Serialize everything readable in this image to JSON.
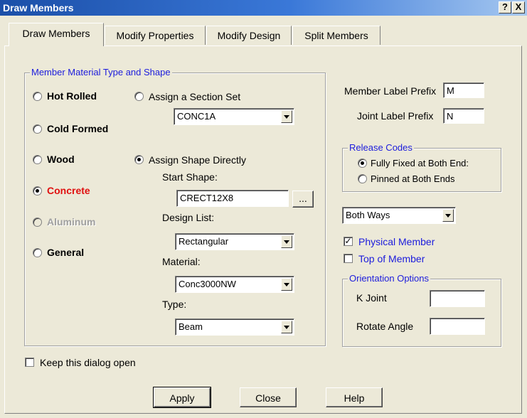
{
  "window": {
    "title": "Draw Members",
    "help_btn": "?",
    "close_btn": "X"
  },
  "tabs": [
    {
      "label": "Draw Members"
    },
    {
      "label": "Modify Properties"
    },
    {
      "label": "Modify Design"
    },
    {
      "label": "Split Members"
    }
  ],
  "material_group": {
    "legend": "Member Material Type and Shape",
    "types": [
      {
        "label": "Hot Rolled",
        "checked": false,
        "disabled": false
      },
      {
        "label": "Cold Formed",
        "checked": false,
        "disabled": false
      },
      {
        "label": "Wood",
        "checked": false,
        "disabled": false
      },
      {
        "label": "Concrete",
        "checked": true,
        "disabled": false
      },
      {
        "label": "Aluminum",
        "checked": false,
        "disabled": true
      },
      {
        "label": "General",
        "checked": false,
        "disabled": false
      }
    ],
    "assign_section_set": "Assign a Section Set",
    "section_set_value": "CONC1A",
    "assign_shape_directly": "Assign Shape Directly",
    "start_shape_label": "Start Shape:",
    "start_shape_value": "CRECT12X8",
    "browse_btn": "...",
    "design_list_label": "Design List:",
    "design_list_value": "Rectangular",
    "material_label": "Material:",
    "material_value": "Conc3000NW",
    "type_label": "Type:",
    "type_value": "Beam"
  },
  "labels": {
    "member_prefix_label": "Member Label Prefix",
    "member_prefix_value": "M",
    "joint_prefix_label": "Joint Label Prefix",
    "joint_prefix_value": "N"
  },
  "release_codes": {
    "legend": "Release Codes",
    "fully_fixed": "Fully Fixed at Both End:",
    "pinned": "Pinned at Both Ends"
  },
  "direction_value": "Both Ways",
  "physical_member": "Physical Member",
  "top_of_member": "Top of Member",
  "orientation": {
    "legend": "Orientation Options",
    "k_joint_label": "K Joint",
    "k_joint_value": "",
    "rotate_angle_label": "Rotate Angle",
    "rotate_angle_value": ""
  },
  "keep_open": "Keep this dialog open",
  "buttons": {
    "apply": "Apply",
    "close": "Close",
    "help": "Help"
  },
  "colors": {
    "title_bar": "#1b4fa8",
    "dialog_bg": "#ece9d8",
    "accent_blue": "#1c1cdc",
    "concrete_red": "#e01010"
  }
}
